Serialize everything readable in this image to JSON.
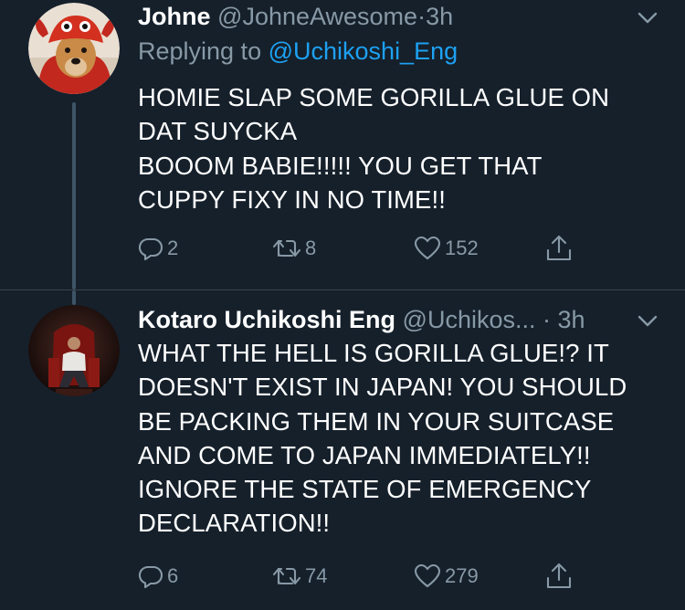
{
  "tweets": [
    {
      "display_name": "Johne",
      "handle": "@JohneAwesome",
      "dot": "·",
      "time": "3h",
      "replying_prefix": "Replying to",
      "replying_handle": "@Uchikoshi_Eng",
      "body_lines": [
        "HOMIE SLAP SOME GORILLA GLUE ON",
        "DAT SUYCKA",
        "BOOOM BABIE!!!!! YOU GET THAT",
        "CUPPY FIXY IN NO TIME!!"
      ],
      "replies": "2",
      "retweets": "8",
      "likes": "152"
    },
    {
      "display_name": "Kotaro Uchikoshi Eng",
      "handle": "@Uchikos...",
      "dot": "·",
      "time": "3h",
      "body_lines": [
        "WHAT THE HELL IS GORILLA GLUE!? IT",
        "DOESN'T EXIST IN JAPAN! YOU SHOULD",
        "BE PACKING THEM IN YOUR SUITCASE",
        "AND COME TO JAPAN IMMEDIATELY!!",
        "IGNORE THE STATE OF EMERGENCY",
        "DECLARATION!!"
      ],
      "replies": "6",
      "retweets": "74",
      "likes": "279"
    }
  ],
  "icons": {
    "reply": "reply-icon",
    "retweet": "retweet-icon",
    "like": "heart-icon",
    "share": "share-icon",
    "caret": "chevron-down-icon"
  },
  "colors": {
    "background": "#15202b",
    "secondary_text": "#8899a6",
    "link": "#1da1f2",
    "thread_line": "#3d5466"
  }
}
